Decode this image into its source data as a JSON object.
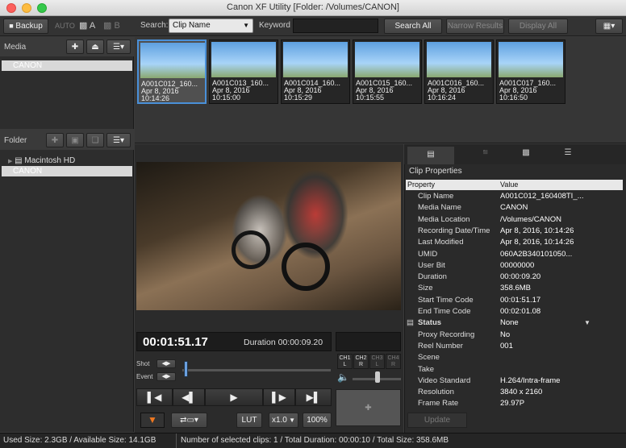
{
  "window": {
    "title": "Canon XF Utility   [Folder: /Volumes/CANON]"
  },
  "toolbar": {
    "backup_label": "Backup",
    "auto_label": "AUTO",
    "folder_a_label": "A",
    "folder_b_label": "B",
    "search_label": "Search:",
    "search_field_value": "Clip Name",
    "keyword_label": "Keyword",
    "keyword_value": "",
    "search_all_label": "Search All",
    "narrow_results_label": "Narrow Results",
    "display_all_label": "Display All"
  },
  "media_panel": {
    "title": "Media",
    "items": [
      {
        "label": "CANON"
      }
    ]
  },
  "folder_panel": {
    "title": "Folder",
    "items": [
      {
        "label": "Macintosh HD"
      },
      {
        "label": "CANON"
      }
    ]
  },
  "clips": [
    {
      "name": "A001C012_160...",
      "date": "Apr 8, 2016",
      "time": "10:14:26"
    },
    {
      "name": "A001C013_160...",
      "date": "Apr 8, 2016",
      "time": "10:15:00"
    },
    {
      "name": "A001C014_160...",
      "date": "Apr 8, 2016",
      "time": "10:15:29"
    },
    {
      "name": "A001C015_160...",
      "date": "Apr 8, 2016",
      "time": "10:15:55"
    },
    {
      "name": "A001C016_160...",
      "date": "Apr 8, 2016",
      "time": "10:16:24"
    },
    {
      "name": "A001C017_160...",
      "date": "Apr 8, 2016",
      "time": "10:16:50"
    }
  ],
  "player": {
    "timecode": "00:01:51.17",
    "duration_text": "Duration 00:00:09.20",
    "shot_label": "Shot",
    "event_label": "Event",
    "channels": [
      "CH1\nL",
      "CH2\nR",
      "CH3\nL",
      "CH4\nR"
    ],
    "lut_label": "LUT",
    "speed_label": "x1.0",
    "zoom_label": "100%",
    "position_fraction": 0.02
  },
  "properties": {
    "title": "Clip Properties",
    "col_property": "Property",
    "col_value": "Value",
    "rows": [
      {
        "name": "Clip Name",
        "value": "A001C012_160408TI_..."
      },
      {
        "name": "Media Name",
        "value": "CANON"
      },
      {
        "name": "Media Location",
        "value": "/Volumes/CANON"
      },
      {
        "name": "Recording Date/Time",
        "value": "Apr 8, 2016, 10:14:26"
      },
      {
        "name": "Last Modified",
        "value": "Apr 8, 2016, 10:14:26"
      },
      {
        "name": "UMID",
        "value": "060A2B340101050..."
      },
      {
        "name": "User Bit",
        "value": "00000000"
      },
      {
        "name": "Duration",
        "value": "00:00:09.20"
      },
      {
        "name": "Size",
        "value": "358.6MB"
      },
      {
        "name": "Start Time Code",
        "value": "00:01:51.17"
      },
      {
        "name": "End Time Code",
        "value": "00:02:01.08"
      },
      {
        "name": "Status",
        "value": "None"
      },
      {
        "name": "Proxy Recording",
        "value": "No"
      },
      {
        "name": "Reel Number",
        "value": "001"
      },
      {
        "name": "Scene",
        "value": ""
      },
      {
        "name": "Take",
        "value": ""
      },
      {
        "name": "Video Standard",
        "value": "H.264/Intra-frame"
      },
      {
        "name": "Resolution",
        "value": "3840 x 2160"
      },
      {
        "name": "Frame Rate",
        "value": "29.97P"
      }
    ],
    "update_label": "Update"
  },
  "status": {
    "left": "Used Size: 2.3GB / Available Size: 14.1GB",
    "right": "Number of selected clips: 1 / Total Duration: 00:00:10 / Total Size: 358.6MB"
  }
}
